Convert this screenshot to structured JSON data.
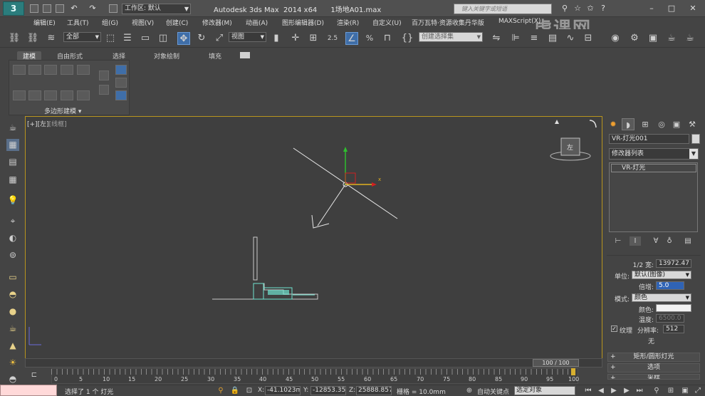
{
  "title_bar": {
    "workspace_label": "工作区: 默认",
    "window_title": "Autodesk 3ds Max  2014 x64      1场地A01.max",
    "search_placeholder": "键入关键字或短语"
  },
  "menu": {
    "items": [
      "编辑(E)",
      "工具(T)",
      "组(G)",
      "视图(V)",
      "创建(C)",
      "修改器(M)",
      "动画(A)",
      "图形编辑器(D)",
      "渲染(R)",
      "自定义(U)",
      "百万瓦特·资源收集丹华版",
      "MAXScript(X)"
    ],
    "watermark": "虎课网"
  },
  "toolbar": {
    "selection_filter": "全部",
    "reference_coord": "视图",
    "selection_set_placeholder": "创建选择集",
    "snap_angle_label": "2.5",
    "percent_label": "%"
  },
  "ribbon": {
    "tabs": [
      "建模",
      "自由形式",
      "选择",
      "对象绘制",
      "填充"
    ],
    "panel_label": "多边形建模 ▾"
  },
  "viewport": {
    "label_bracket": "[+]",
    "label_view": "[左]",
    "label_shading": "[线框]",
    "cube_face": "左",
    "axis_x": "x"
  },
  "command_panel": {
    "object_name": "VR-灯光001",
    "modifier_list": "修改器列表",
    "stack_item": "VR-灯光",
    "params": {
      "half_width_label": "1/2 宽:",
      "half_width_value": "13972.47",
      "units_label": "单位:",
      "units_value": "默认(图像)",
      "multiplier_label": "倍增:",
      "multiplier_value": "5.0",
      "mode_label": "模式:",
      "mode_value": "颜色",
      "color_label": "颜色:",
      "temperature_label": "温度:",
      "temperature_value": "6500.0",
      "texture_label": "纹理",
      "resolution_label": "分辨率:",
      "resolution_value": "512",
      "none_label": "无"
    },
    "rollouts": [
      "矩形/圆形灯光",
      "选项",
      "采样"
    ]
  },
  "timeline": {
    "frame_display": "100 / 100",
    "ticks": [
      "0",
      "5",
      "10",
      "15",
      "20",
      "25",
      "30",
      "35",
      "40",
      "45",
      "50",
      "55",
      "60",
      "65",
      "70",
      "75",
      "80",
      "85",
      "90",
      "95",
      "100"
    ]
  },
  "status": {
    "selection_text": "选择了 1 个 灯光",
    "x_label": "X:",
    "x_value": "-41.1023m",
    "y_label": "Y:",
    "y_value": "-12853.35",
    "z_label": "Z:",
    "z_value": "25888.857",
    "grid_label": "栅格 = 10.0mm",
    "autokey_label": "自动关键点",
    "set_key_value": "选定对象"
  },
  "colors": {
    "viewport_border": "#b8941e",
    "highlight_blue": "#2f63b5",
    "model_cyan": "#6fe3cf"
  }
}
